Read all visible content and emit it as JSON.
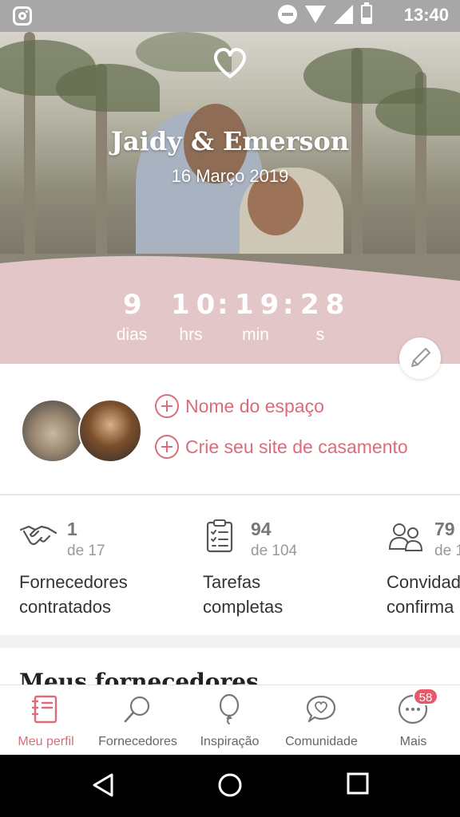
{
  "status_bar": {
    "time": "13:40",
    "icons": [
      "instagram-icon",
      "do-not-disturb-icon",
      "wifi-icon",
      "signal-icon",
      "battery-icon"
    ]
  },
  "hero": {
    "couple_names": "Jaidy & Emerson",
    "wedding_date": "16 Março 2019",
    "logo_icon": "heart-icon"
  },
  "countdown": {
    "days": "9",
    "hours": "10",
    "minutes": "19",
    "seconds": "28",
    "separator": ":",
    "days_label": "dias",
    "hours_label": "hrs",
    "minutes_label": "min",
    "seconds_label": "s",
    "edit_icon": "pencil-icon"
  },
  "profile": {
    "actions": [
      {
        "label": "Nome do espaço",
        "icon": "plus-circle-icon"
      },
      {
        "label": "Crie seu site de casamento",
        "icon": "plus-circle-icon"
      }
    ]
  },
  "stats": [
    {
      "count": "1",
      "total": "de 17",
      "title_line1": "Fornecedores",
      "title_line2": "contratados",
      "icon": "handshake-icon"
    },
    {
      "count": "94",
      "total": "de 104",
      "title_line1": "Tarefas",
      "title_line2": "completas",
      "icon": "checklist-icon"
    },
    {
      "count": "79",
      "total": "de 1",
      "title_line1": "Convidad",
      "title_line2": "confirma",
      "icon": "guests-icon"
    }
  ],
  "section": {
    "title": "Meus fornecedores"
  },
  "bottom_nav": {
    "items": [
      {
        "label": "Meu perfil",
        "icon": "notebook-icon",
        "active": true
      },
      {
        "label": "Fornecedores",
        "icon": "search-icon",
        "active": false
      },
      {
        "label": "Inspiração",
        "icon": "balloon-icon",
        "active": false
      },
      {
        "label": "Comunidade",
        "icon": "chat-heart-icon",
        "active": false
      },
      {
        "label": "Mais",
        "icon": "more-icon",
        "active": false
      }
    ],
    "badge": "58"
  },
  "colors": {
    "accent": "#de6b7a",
    "band": "#e3c6c7",
    "status_bar": "#a7a7a7"
  }
}
